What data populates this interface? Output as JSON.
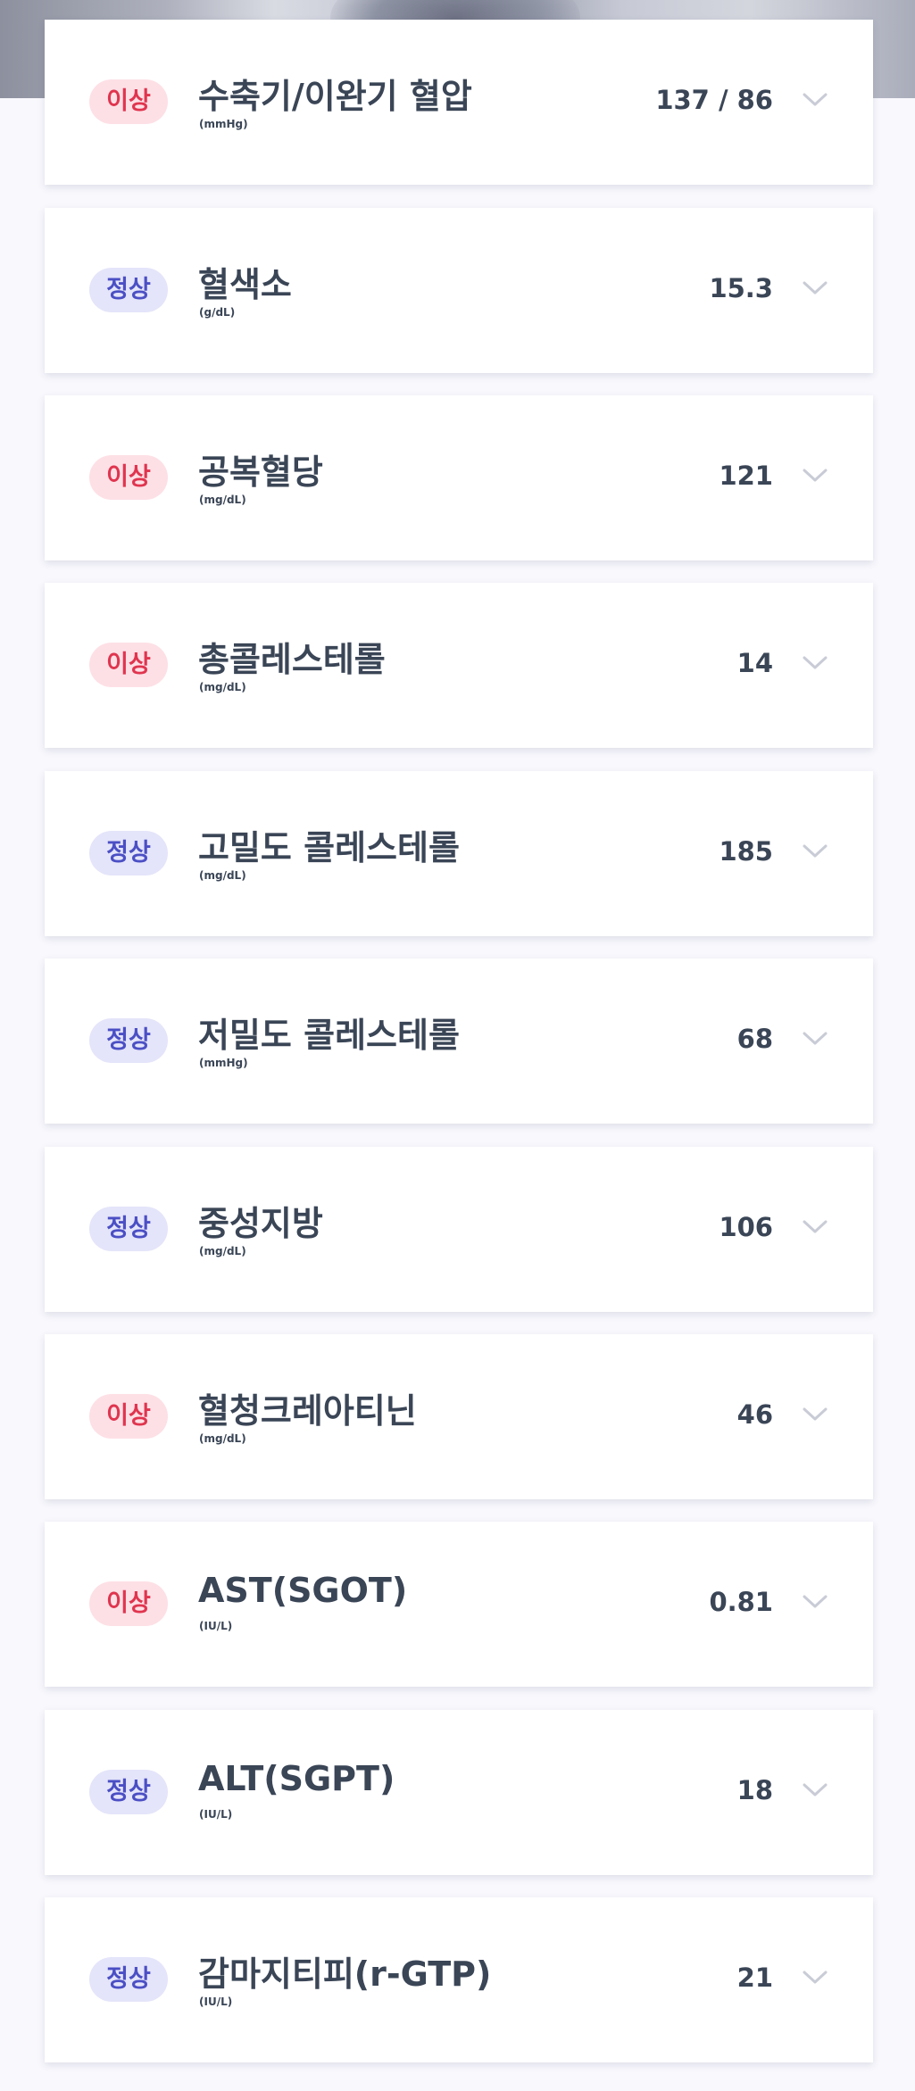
{
  "results": [
    {
      "status": "이상",
      "status_type": "abnormal",
      "name": "수축기/이완기 혈압",
      "unit": "(mmHg)",
      "value": "137 / 86",
      "icon": "chevron-down-icon"
    },
    {
      "status": "정상",
      "status_type": "normal",
      "name": "혈색소",
      "unit": "(g/dL)",
      "value": "15.3",
      "icon": "chevron-down-icon"
    },
    {
      "status": "이상",
      "status_type": "abnormal",
      "name": "공복혈당",
      "unit": "(mg/dL)",
      "value": "121",
      "icon": "chevron-down-icon"
    },
    {
      "status": "이상",
      "status_type": "abnormal",
      "name": "총콜레스테롤",
      "unit": "(mg/dL)",
      "value": "14",
      "icon": "chevron-down-icon"
    },
    {
      "status": "정상",
      "status_type": "normal",
      "name": "고밀도 콜레스테롤",
      "unit": "(mg/dL)",
      "value": "185",
      "icon": "chevron-down-icon"
    },
    {
      "status": "정상",
      "status_type": "normal",
      "name": "저밀도 콜레스테롤",
      "unit": "(mmHg)",
      "value": "68",
      "icon": "chevron-down-icon"
    },
    {
      "status": "정상",
      "status_type": "normal",
      "name": "중성지방",
      "unit": "(mg/dL)",
      "value": "106",
      "icon": "chevron-down-icon"
    },
    {
      "status": "이상",
      "status_type": "abnormal",
      "name": "혈청크레아티닌",
      "unit": "(mg/dL)",
      "value": "46",
      "icon": "chevron-down-icon"
    },
    {
      "status": "이상",
      "status_type": "abnormal",
      "name": "AST(SGOT)",
      "unit": "(IU/L)",
      "value": "0.81",
      "icon": "chevron-down-icon"
    },
    {
      "status": "정상",
      "status_type": "normal",
      "name": "ALT(SGPT)",
      "unit": "(IU/L)",
      "value": "18",
      "icon": "chevron-down-icon"
    },
    {
      "status": "정상",
      "status_type": "normal",
      "name": "감마지티피(r-GTP)",
      "unit": "(IU/L)",
      "value": "21",
      "icon": "chevron-down-icon"
    }
  ],
  "colors": {
    "abnormal_text": "#e0354f",
    "abnormal_bg": "#fde0e6",
    "normal_text": "#4b4fc4",
    "normal_bg": "#e4e4fa",
    "text": "#3a4556",
    "chevron": "#c9ccd6"
  }
}
